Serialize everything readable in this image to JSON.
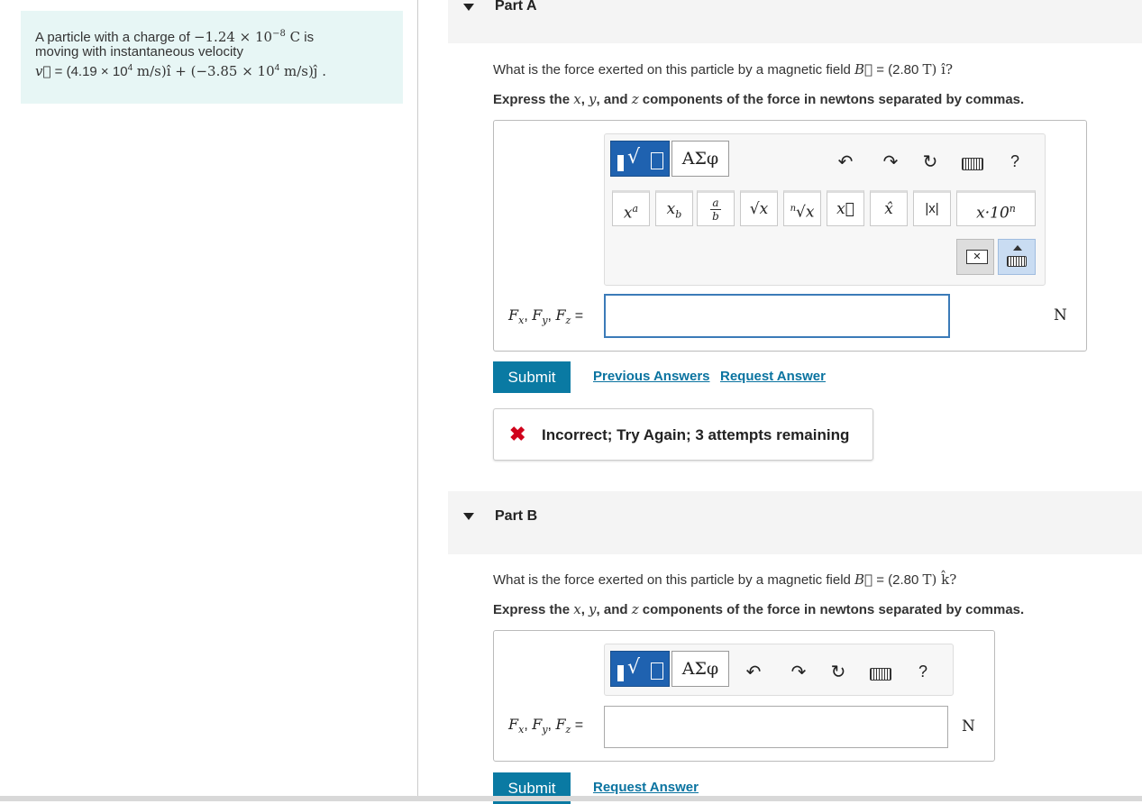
{
  "problem": {
    "line1_prefix": "A particle with a charge of ",
    "charge": "−1.24 × 10",
    "charge_exp": "−8",
    "charge_unit": " C",
    "line1_suffix": " is",
    "line2": "moving with instantaneous velocity",
    "velocity_label": "v⃗",
    "velocity_expr": " = (4.19 × 10",
    "vx_exp": "4",
    "vx_unit": " m/s)î + (−3.85 × 10",
    "vy_exp": "4",
    "vy_unit": " m/s)ĵ ."
  },
  "partA": {
    "title": "Part A",
    "question_prefix": "What is the force exerted on this particle by a magnetic field ",
    "field_symbol": "B⃗",
    "field_value": " = (2.80 ",
    "field_unit": "T",
    "field_dir": ") î?",
    "instruction_prefix": "Express the ",
    "var_x": "x",
    "var_y": "y",
    "var_z": "z",
    "instruction_and": ", and ",
    "instruction_suffix": " components of the force in newtons separated by commas.",
    "comma": ", ",
    "answer_label_F": "F",
    "sub_x": "x",
    "sub_y": "y",
    "sub_z": "z",
    "answer_eq": " =",
    "unit": "N",
    "submit_label": "Submit",
    "previous_answers": "Previous Answers",
    "request_answer": "Request Answer",
    "feedback": "Incorrect; Try Again; 3 attempts remaining"
  },
  "partB": {
    "title": "Part B",
    "question_prefix": "What is the force exerted on this particle by a magnetic field ",
    "field_symbol": "B⃗",
    "field_value": " = (2.80 ",
    "field_unit": "T",
    "field_dir": ") k̂?",
    "instruction_prefix": "Express the ",
    "var_x": "x",
    "var_y": "y",
    "var_z": "z",
    "instruction_and": ", and ",
    "instruction_suffix": " components of the force in newtons separated by commas.",
    "comma": ", ",
    "answer_label_F": "F",
    "sub_x": "x",
    "sub_y": "y",
    "sub_z": "z",
    "answer_eq": " =",
    "unit": "N",
    "submit_label": "Submit",
    "request_answer": "Request Answer"
  },
  "toolbar": {
    "greek_label": "ΑΣφ",
    "help_label": "?",
    "keys": [
      "xa",
      "xb",
      "a/b",
      "√x",
      "ⁿ√x",
      "x⃗",
      "x̂",
      "|x|",
      "x·10ⁿ"
    ],
    "key_xa_base": "x",
    "key_xa_sup": "a",
    "key_xb_base": "x",
    "key_xb_sub": "b",
    "key_frac_num": "a",
    "key_frac_den": "b",
    "key_sqrt": "√x",
    "key_nroot_n": "n",
    "key_nroot": "√x",
    "key_vec": "x⃗",
    "key_hat": "x̂",
    "key_abs": "|x|",
    "key_sci": "x·10",
    "key_sci_sup": "n",
    "undo_icon": "undo-icon",
    "redo_icon": "redo-icon",
    "reset_icon": "reset-icon",
    "keyboard_icon": "keyboard-icon"
  },
  "colors": {
    "submit": "#0a7aa3",
    "link": "#0a73a0",
    "template_button": "#1f62b0",
    "problem_bg": "#e7f6f5",
    "error": "#d0021b"
  }
}
